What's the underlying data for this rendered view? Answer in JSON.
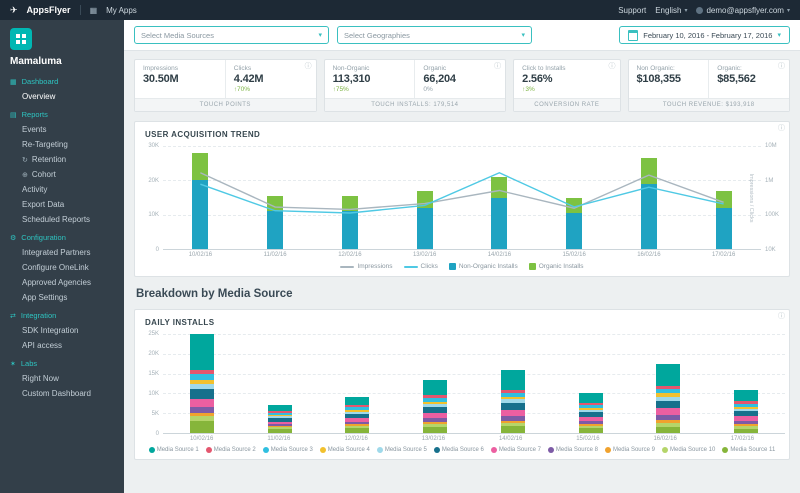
{
  "topbar": {
    "brand": "AppsFlyer",
    "my_apps": "My Apps",
    "support": "Support",
    "language": "English",
    "account": "demo@appsflyer.com"
  },
  "sidebar": {
    "app_name": "Mamaluma",
    "sections": [
      {
        "label": "Dashboard",
        "icon": "dashboard-icon",
        "glyph": "▦",
        "items": [
          {
            "label": "Overview",
            "active": true
          }
        ]
      },
      {
        "label": "Reports",
        "icon": "reports-icon",
        "glyph": "▤",
        "items": [
          {
            "label": "Events"
          },
          {
            "label": "Re-Targeting"
          },
          {
            "label": "Retention",
            "icon": "retention-icon",
            "glyph": "↻"
          },
          {
            "label": "Cohort",
            "icon": "cohort-icon",
            "glyph": "⊕"
          },
          {
            "label": "Activity"
          },
          {
            "label": "Export Data"
          },
          {
            "label": "Scheduled Reports"
          }
        ]
      },
      {
        "label": "Configuration",
        "icon": "configuration-gear-icon",
        "glyph": "⚙",
        "items": [
          {
            "label": "Integrated Partners"
          },
          {
            "label": "Configure OneLink"
          },
          {
            "label": "Approved Agencies"
          },
          {
            "label": "App Settings"
          }
        ]
      },
      {
        "label": "Integration",
        "icon": "integration-icon",
        "glyph": "⇄",
        "items": [
          {
            "label": "SDK Integration"
          },
          {
            "label": "API access"
          }
        ]
      },
      {
        "label": "Labs",
        "icon": "labs-icon",
        "glyph": "✶",
        "items": [
          {
            "label": "Right Now"
          },
          {
            "label": "Custom Dashboard"
          }
        ]
      }
    ]
  },
  "filters": {
    "media_sources": "Select Media Sources",
    "geographies": "Select Geographies",
    "date_range": "February 10, 2016 - February 17, 2016"
  },
  "kpis": [
    {
      "footer": "TOUCH POINTS",
      "info": true,
      "metrics": [
        {
          "label": "Impressions",
          "value": "30.50M",
          "change": ""
        },
        {
          "label": "Clicks",
          "value": "4.42M",
          "change": "↑70%"
        }
      ]
    },
    {
      "footer": "TOUCH INSTALLS: 179,514",
      "info": true,
      "metrics": [
        {
          "label": "Non-Organic",
          "value": "113,310",
          "change": "↑75%"
        },
        {
          "label": "Organic",
          "value": "66,204",
          "change": "0%"
        }
      ]
    },
    {
      "footer": "CONVERSION RATE",
      "info": true,
      "metrics": [
        {
          "label": "Click to Installs",
          "value": "2.56%",
          "change": "↑3%"
        }
      ]
    },
    {
      "footer": "TOUCH REVENUE: $193,918",
      "info": true,
      "metrics": [
        {
          "label": "Non Organic:",
          "value": "$108,355",
          "change": ""
        },
        {
          "label": "Organic:",
          "value": "$85,562",
          "change": ""
        }
      ]
    }
  ],
  "section_heading": "Breakdown by Media Source",
  "chart_data": [
    {
      "type": "bar",
      "title": "USER ACQUISITION TREND",
      "categories": [
        "10/02/16",
        "11/02/16",
        "12/02/16",
        "13/02/16",
        "14/02/16",
        "15/02/16",
        "16/02/16",
        "17/02/16"
      ],
      "ylim": [
        0,
        30000
      ],
      "left_ticks": [
        "30K",
        "20K",
        "10K",
        "0"
      ],
      "right_ticks": [
        "10M",
        "1M",
        "100K",
        "10K"
      ],
      "right_axis_label": "Impressions / Clicks",
      "grid": true,
      "legend_position": "bottom",
      "bar_series": [
        {
          "name": "Non-Organic Installs",
          "color": "#1fa3c2",
          "values": [
            20000,
            11000,
            11000,
            12000,
            15000,
            10500,
            19000,
            12000
          ]
        },
        {
          "name": "Organic Installs",
          "color": "#7dc242",
          "values": [
            8000,
            4500,
            4500,
            5000,
            6000,
            4500,
            7500,
            5000
          ]
        }
      ],
      "line_series": [
        {
          "name": "Impressions",
          "color": "#a9b6bf",
          "values": [
            6100000,
            3200000,
            3000000,
            3500000,
            4600000,
            3100000,
            5900000,
            3600000
          ]
        },
        {
          "name": "Clicks",
          "color": "#4fc9e4",
          "values": [
            800000,
            450000,
            420000,
            520000,
            950000,
            500000,
            760000,
            540000
          ]
        }
      ]
    },
    {
      "type": "bar",
      "title": "DAILY INSTALLS",
      "categories": [
        "10/02/16",
        "11/02/16",
        "12/02/16",
        "13/02/16",
        "14/02/16",
        "15/02/16",
        "16/02/16",
        "17/02/16"
      ],
      "ylim": [
        0,
        25000
      ],
      "left_ticks": [
        "25K",
        "20K",
        "15K",
        "10K",
        "5K",
        "0"
      ],
      "grid": true,
      "legend_position": "bottom",
      "series": [
        {
          "name": "Media Source 1",
          "color": "#00a79d",
          "values": [
            9000,
            1500,
            2000,
            4000,
            5000,
            2500,
            5500,
            3000
          ]
        },
        {
          "name": "Media Source 2",
          "color": "#e4566e",
          "values": [
            1200,
            400,
            500,
            700,
            800,
            500,
            900,
            600
          ]
        },
        {
          "name": "Media Source 3",
          "color": "#30bfe0",
          "values": [
            1500,
            500,
            600,
            900,
            1000,
            700,
            1100,
            700
          ]
        },
        {
          "name": "Media Source 4",
          "color": "#f2c12e",
          "values": [
            1000,
            400,
            500,
            600,
            700,
            500,
            800,
            500
          ]
        },
        {
          "name": "Media Source 5",
          "color": "#9fd9ea",
          "values": [
            1300,
            500,
            600,
            800,
            900,
            600,
            1000,
            700
          ]
        },
        {
          "name": "Media Source 6",
          "color": "#17708c",
          "values": [
            2500,
            800,
            1000,
            1500,
            1800,
            1200,
            2000,
            1300
          ]
        },
        {
          "name": "Media Source 7",
          "color": "#ec5fa1",
          "values": [
            2000,
            700,
            900,
            1300,
            1500,
            1000,
            1700,
            1100
          ]
        },
        {
          "name": "Media Source 8",
          "color": "#7d5ba6",
          "values": [
            1500,
            500,
            700,
            1000,
            1200,
            800,
            1300,
            900
          ]
        },
        {
          "name": "Media Source 9",
          "color": "#f0a22e",
          "values": [
            800,
            300,
            400,
            500,
            600,
            400,
            700,
            500
          ]
        },
        {
          "name": "Media Source 10",
          "color": "#b5d56a",
          "values": [
            1200,
            400,
            500,
            700,
            800,
            600,
            900,
            600
          ]
        },
        {
          "name": "Media Source 11",
          "color": "#86b53a",
          "values": [
            3000,
            1000,
            1300,
            1500,
            1700,
            1200,
            1600,
            1100
          ]
        }
      ]
    }
  ]
}
